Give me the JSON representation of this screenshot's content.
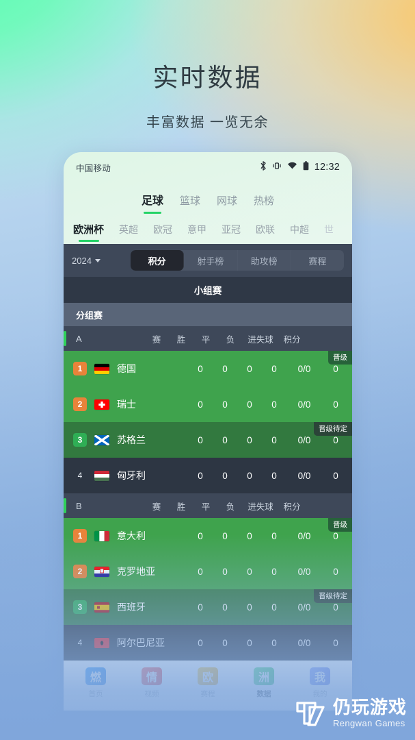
{
  "hero": {
    "title": "实时数据",
    "subtitle": "丰富数据 一览无余"
  },
  "colors": {
    "accent_green": "#24d366",
    "row_green": "#3fa34d",
    "row_green_dark": "#32793f",
    "row_dark": "#2d3643",
    "panel_dark": "#3e4859",
    "rank_orange": "#e8833a",
    "rank_green": "#2fae55",
    "bg_mint": "#5FFCB4",
    "bg_amber": "#FFD180",
    "bg_blue": "#7FA8DC"
  },
  "statusbar": {
    "carrier": "中国移动",
    "time": "12:32",
    "icons": [
      "bluetooth-icon",
      "vibrate-icon",
      "wifi-icon",
      "battery-icon"
    ]
  },
  "sport_tabs": [
    {
      "label": "足球",
      "active": true
    },
    {
      "label": "篮球",
      "active": false
    },
    {
      "label": "网球",
      "active": false
    },
    {
      "label": "热榜",
      "active": false
    }
  ],
  "league_tabs": [
    {
      "label": "欧洲杯",
      "active": true
    },
    {
      "label": "英超",
      "active": false
    },
    {
      "label": "欧冠",
      "active": false
    },
    {
      "label": "意甲",
      "active": false
    },
    {
      "label": "亚冠",
      "active": false
    },
    {
      "label": "欧联",
      "active": false
    },
    {
      "label": "中超",
      "active": false
    },
    {
      "label": "世",
      "active": false,
      "clipped": true
    }
  ],
  "control_bar": {
    "year": "2024",
    "segments": [
      {
        "label": "积分",
        "active": true
      },
      {
        "label": "射手榜",
        "active": false
      },
      {
        "label": "助攻榜",
        "active": false
      },
      {
        "label": "赛程",
        "active": false
      }
    ]
  },
  "stage_title": "小组赛",
  "group_title": "分组赛",
  "columns": [
    "赛",
    "胜",
    "平",
    "负",
    "进失球",
    "积分"
  ],
  "groups": [
    {
      "letter": "A",
      "rows": [
        {
          "rank": "1",
          "rank_style": "orange",
          "team": "德国",
          "flag": "flag-de",
          "played": "0",
          "win": "0",
          "draw": "0",
          "loss": "0",
          "goals": "0/0",
          "points": "0",
          "row_style": "g1",
          "badge": "晋级",
          "badge_style": "up"
        },
        {
          "rank": "2",
          "rank_style": "orange",
          "team": "瑞士",
          "flag": "flag-ch",
          "played": "0",
          "win": "0",
          "draw": "0",
          "loss": "0",
          "goals": "0/0",
          "points": "0",
          "row_style": "g1",
          "badge": "",
          "badge_style": ""
        },
        {
          "rank": "3",
          "rank_style": "green",
          "team": "苏格兰",
          "flag": "flag-sc",
          "played": "0",
          "win": "0",
          "draw": "0",
          "loss": "0",
          "goals": "0/0",
          "points": "0",
          "row_style": "g2",
          "badge": "晋级待定",
          "badge_style": "pend"
        },
        {
          "rank": "4",
          "rank_style": "plain",
          "team": "匈牙利",
          "flag": "flag-hu",
          "played": "0",
          "win": "0",
          "draw": "0",
          "loss": "0",
          "goals": "0/0",
          "points": "0",
          "row_style": "g0",
          "badge": "",
          "badge_style": ""
        }
      ]
    },
    {
      "letter": "B",
      "rows": [
        {
          "rank": "1",
          "rank_style": "orange",
          "team": "意大利",
          "flag": "flag-it",
          "played": "0",
          "win": "0",
          "draw": "0",
          "loss": "0",
          "goals": "0/0",
          "points": "0",
          "row_style": "g1",
          "badge": "晋级",
          "badge_style": "up"
        },
        {
          "rank": "2",
          "rank_style": "orange",
          "team": "克罗地亚",
          "flag": "flag-hr",
          "played": "0",
          "win": "0",
          "draw": "0",
          "loss": "0",
          "goals": "0/0",
          "points": "0",
          "row_style": "g1",
          "badge": "",
          "badge_style": ""
        },
        {
          "rank": "3",
          "rank_style": "green",
          "team": "西班牙",
          "flag": "flag-es",
          "played": "0",
          "win": "0",
          "draw": "0",
          "loss": "0",
          "goals": "0/0",
          "points": "0",
          "row_style": "g2",
          "badge": "晋级待定",
          "badge_style": "pend"
        },
        {
          "rank": "4",
          "rank_style": "plain",
          "team": "阿尔巴尼亚",
          "flag": "flag-al",
          "played": "0",
          "win": "0",
          "draw": "0",
          "loss": "0",
          "goals": "0/0",
          "points": "0",
          "row_style": "g0",
          "badge": "",
          "badge_style": ""
        }
      ]
    }
  ],
  "bottom_nav": [
    {
      "glyph": "燃",
      "label": "首页",
      "active": false
    },
    {
      "glyph": "情",
      "label": "视频",
      "active": false
    },
    {
      "glyph": "欧",
      "label": "赛程",
      "active": false
    },
    {
      "glyph": "洲",
      "label": "数据",
      "active": true
    },
    {
      "glyph": "我",
      "label": "我的",
      "active": false
    }
  ],
  "watermark": {
    "cn": "仍玩游戏",
    "en": "Rengwan Games"
  }
}
